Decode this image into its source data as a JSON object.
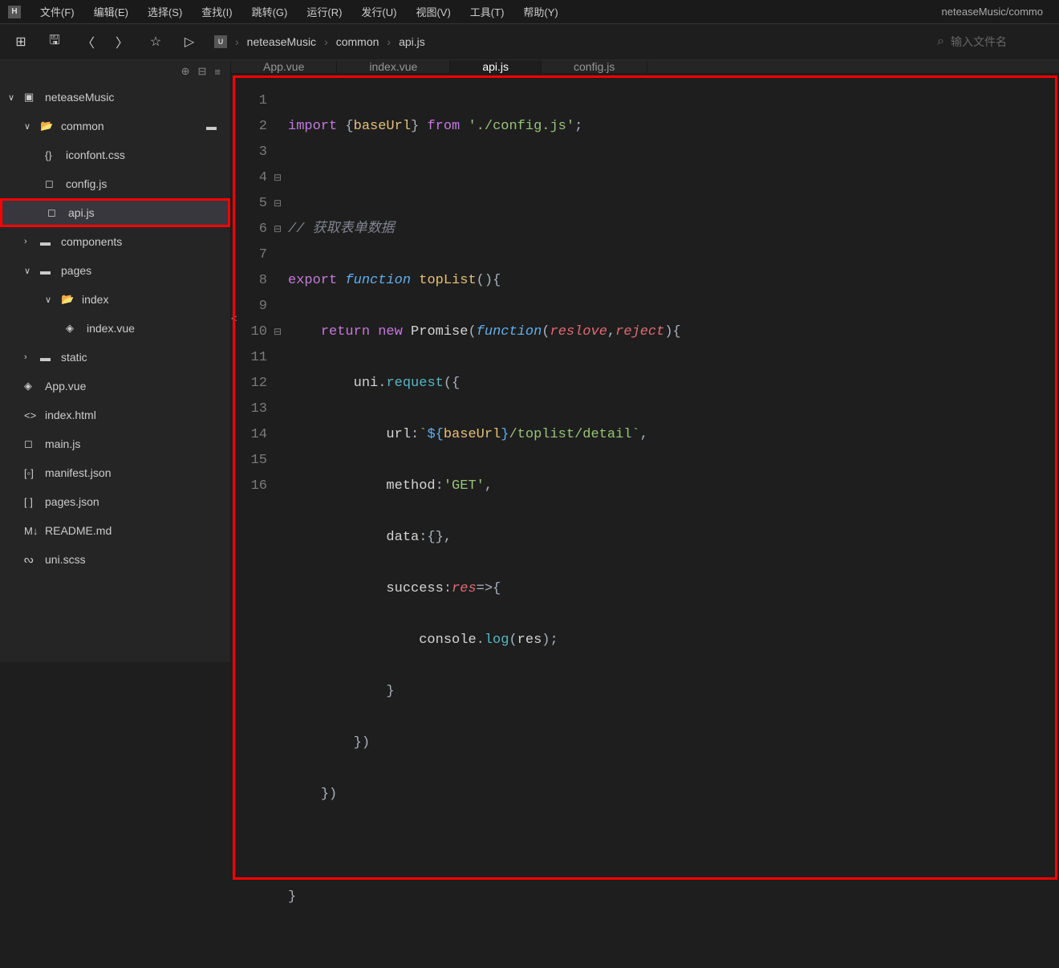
{
  "window": {
    "title": "neteaseMusic/commo"
  },
  "menu": {
    "items": [
      "文件(F)",
      "编辑(E)",
      "选择(S)",
      "查找(I)",
      "跳转(G)",
      "运行(R)",
      "发行(U)",
      "视图(V)",
      "工具(T)",
      "帮助(Y)"
    ]
  },
  "toolbar": {
    "breadcrumb": [
      "neteaseMusic",
      "common",
      "api.js"
    ],
    "search_placeholder": "输入文件名"
  },
  "sidebar": {
    "project": "neteaseMusic",
    "items": [
      {
        "label": "common",
        "type": "folder",
        "open": true,
        "indent": 1
      },
      {
        "label": "iconfont.css",
        "type": "css",
        "indent": 2
      },
      {
        "label": "config.js",
        "type": "js",
        "indent": 2
      },
      {
        "label": "api.js",
        "type": "js",
        "indent": 2,
        "highlighted": true,
        "active": true
      },
      {
        "label": "components",
        "type": "folder",
        "open": false,
        "indent": 1,
        "caret": ">"
      },
      {
        "label": "pages",
        "type": "folder",
        "open": true,
        "indent": 1
      },
      {
        "label": "index",
        "type": "folder",
        "open": true,
        "indent": 2
      },
      {
        "label": "index.vue",
        "type": "vue",
        "indent": 3
      },
      {
        "label": "static",
        "type": "folder",
        "open": false,
        "indent": 1,
        "caret": ">"
      },
      {
        "label": "App.vue",
        "type": "vue",
        "indent": 1
      },
      {
        "label": "index.html",
        "type": "html",
        "indent": 1
      },
      {
        "label": "main.js",
        "type": "js",
        "indent": 1
      },
      {
        "label": "manifest.json",
        "type": "json",
        "indent": 1
      },
      {
        "label": "pages.json",
        "type": "json",
        "indent": 1
      },
      {
        "label": "README.md",
        "type": "md",
        "indent": 1
      },
      {
        "label": "uni.scss",
        "type": "scss",
        "indent": 1
      }
    ]
  },
  "tabs": [
    {
      "label": "App.vue",
      "active": false
    },
    {
      "label": "index.vue",
      "active": false
    },
    {
      "label": "api.js",
      "active": true
    },
    {
      "label": "config.js",
      "active": false
    }
  ],
  "code": {
    "lines": [
      1,
      2,
      3,
      4,
      5,
      6,
      7,
      8,
      9,
      10,
      11,
      12,
      13,
      14,
      15,
      16
    ],
    "fold": {
      "4": "⊟",
      "5": "⊟",
      "6": "⊟",
      "10": "⊟"
    },
    "comment_text": "// 获取表单数据",
    "tokens": {
      "import": "import",
      "from": "from",
      "export": "export",
      "function": "function",
      "return": "return",
      "new": "new",
      "baseUrl": "baseUrl",
      "topList": "topList",
      "Promise": "Promise",
      "reslove": "reslove",
      "reject": "reject",
      "uni": "uni",
      "request": "request",
      "url": "url",
      "method": "method",
      "data": "data",
      "success": "success",
      "res": "res",
      "console": "console",
      "log": "log",
      "configPath": "'./config.js'",
      "toplistPath": "/toplist/detail",
      "get": "'GET'",
      "tickopen": "`",
      "dollar": "${",
      "closebrace": "}",
      "tickclose": "`"
    }
  }
}
